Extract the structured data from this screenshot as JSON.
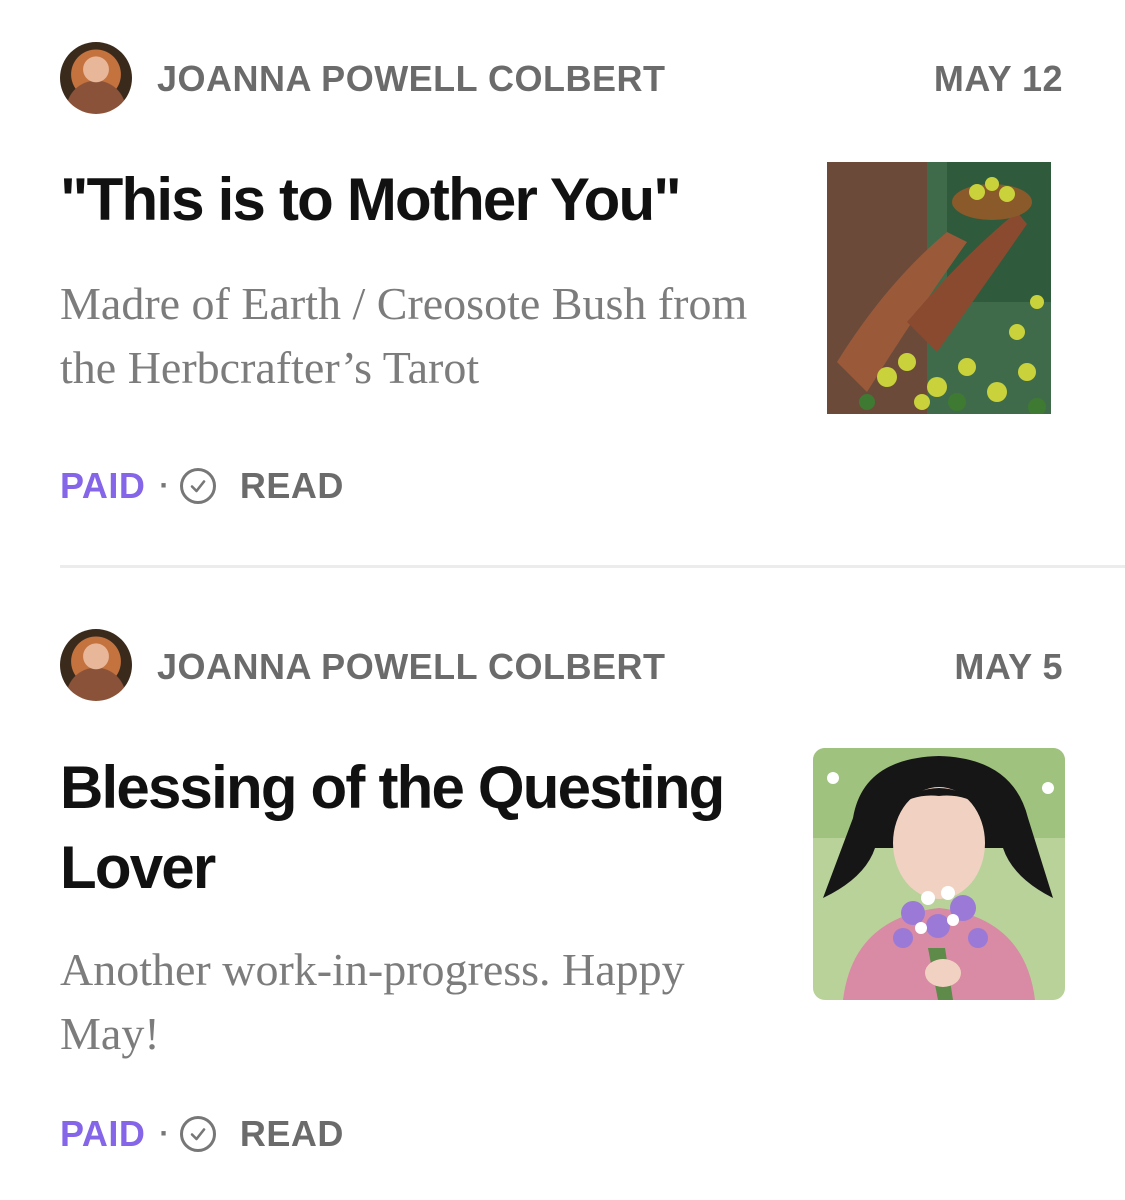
{
  "posts": [
    {
      "author": "JOANNA POWELL COLBERT",
      "date": "MAY 12",
      "title": "\"This is to Mother You\"",
      "subtitle": "Madre of Earth / Creosote Bush from the Herbcrafter’s Tarot",
      "access": "PAID",
      "separator": "·",
      "status": "READ"
    },
    {
      "author": "JOANNA POWELL COLBERT",
      "date": "MAY 5",
      "title": "Blessing of the Questing Lover",
      "subtitle": "Another work-in-progress. Happy May!",
      "access": "PAID",
      "separator": "·",
      "status": "READ"
    }
  ],
  "icons": {
    "avatar": "author-avatar",
    "read": "check-circle-icon"
  },
  "colors": {
    "paid": "#8565e8",
    "meta": "#6b6b6b",
    "title": "#111111",
    "subtitle": "#7c7c7c"
  }
}
